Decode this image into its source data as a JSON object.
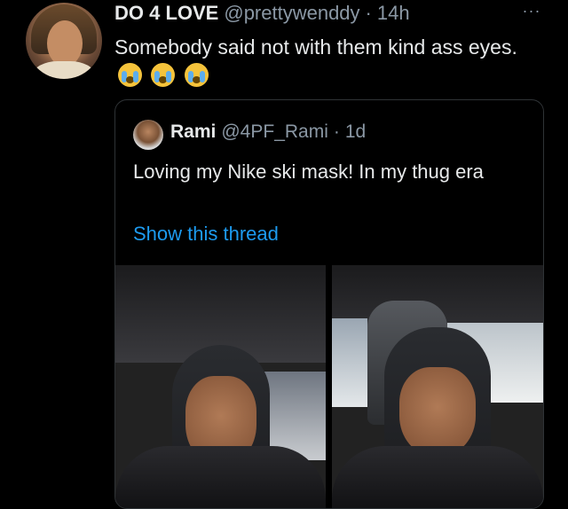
{
  "tweet": {
    "author_name": "DO 4 LOVE",
    "handle": "@prettywenddy",
    "separator": "·",
    "time": "14h",
    "more_label": "···",
    "text": "Somebody said not with them kind ass eyes.",
    "emojis": [
      "loudly-crying-face",
      "loudly-crying-face",
      "loudly-crying-face"
    ]
  },
  "quote": {
    "author_name": "Rami",
    "handle": "@4PF_Rami",
    "separator": "·",
    "time": "1d",
    "text": "Loving my Nike ski mask! In my thug era",
    "show_thread": "Show this thread"
  },
  "colors": {
    "background": "#000000",
    "text": "#e7e9ea",
    "muted": "#8b98a5",
    "link": "#1d9bf0",
    "border": "#2f3336"
  }
}
